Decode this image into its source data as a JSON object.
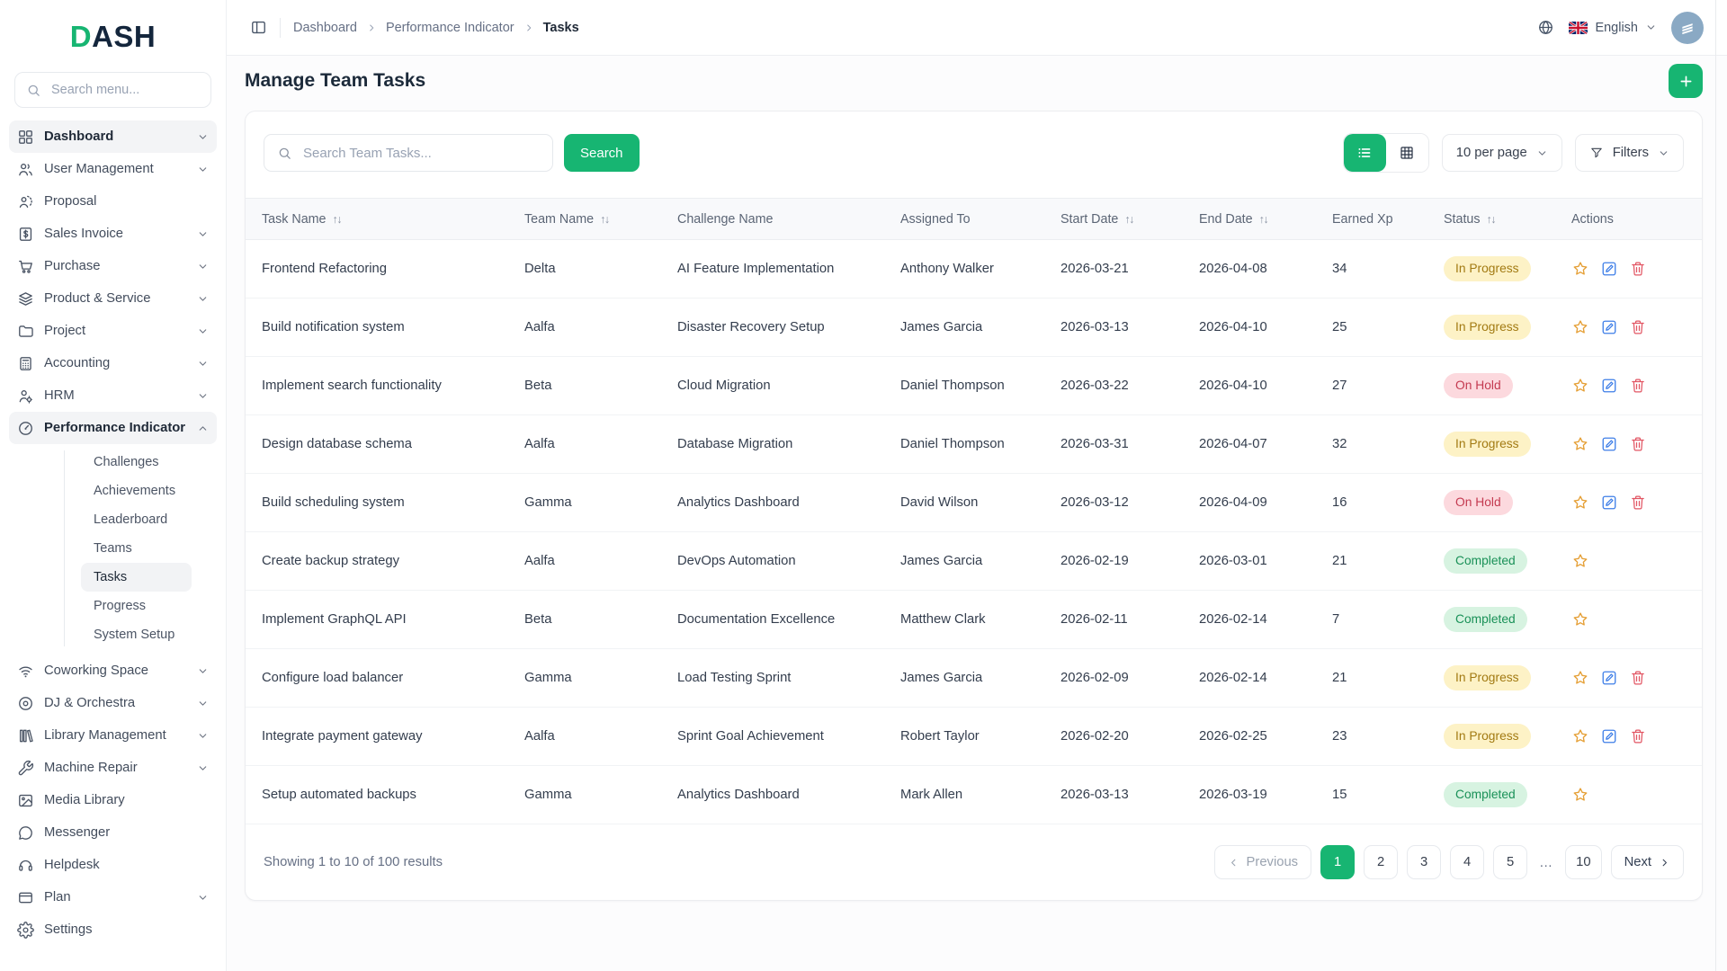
{
  "brand": {
    "logo_first": "D",
    "logo_rest": "ASH"
  },
  "sidebar": {
    "search_placeholder": "Search menu...",
    "items": [
      {
        "label": "Dashboard",
        "icon": "dashboard",
        "chevron": "down",
        "active": true
      },
      {
        "label": "User Management",
        "icon": "users",
        "chevron": "down"
      },
      {
        "label": "Proposal",
        "icon": "proposal"
      },
      {
        "label": "Sales Invoice",
        "icon": "invoice",
        "chevron": "down"
      },
      {
        "label": "Purchase",
        "icon": "cart",
        "chevron": "down"
      },
      {
        "label": "Product & Service",
        "icon": "layers",
        "chevron": "down"
      },
      {
        "label": "Project",
        "icon": "folder",
        "chevron": "down"
      },
      {
        "label": "Accounting",
        "icon": "calculator",
        "chevron": "down"
      },
      {
        "label": "HRM",
        "icon": "hrm",
        "chevron": "down"
      },
      {
        "label": "Performance Indicator",
        "icon": "gauge",
        "chevron": "up",
        "active": true,
        "children": [
          {
            "label": "Challenges"
          },
          {
            "label": "Achievements"
          },
          {
            "label": "Leaderboard"
          },
          {
            "label": "Teams"
          },
          {
            "label": "Tasks",
            "active": true
          },
          {
            "label": "Progress"
          },
          {
            "label": "System Setup"
          }
        ]
      },
      {
        "label": "Coworking Space",
        "icon": "wifi",
        "chevron": "down"
      },
      {
        "label": "DJ & Orchestra",
        "icon": "disc",
        "chevron": "down"
      },
      {
        "label": "Library Management",
        "icon": "book",
        "chevron": "down"
      },
      {
        "label": "Machine Repair",
        "icon": "wrench",
        "chevron": "down"
      },
      {
        "label": "Media Library",
        "icon": "image"
      },
      {
        "label": "Messenger",
        "icon": "chat"
      },
      {
        "label": "Helpdesk",
        "icon": "headset"
      },
      {
        "label": "Plan",
        "icon": "card",
        "chevron": "down"
      },
      {
        "label": "Settings",
        "icon": "gear"
      }
    ]
  },
  "topbar": {
    "breadcrumb": [
      "Dashboard",
      "Performance Indicator",
      "Tasks"
    ],
    "language": "English"
  },
  "page": {
    "title": "Manage Team Tasks"
  },
  "toolbar": {
    "search_placeholder": "Search Team Tasks...",
    "search_button": "Search",
    "per_page": "10 per page",
    "filters_label": "Filters"
  },
  "table": {
    "columns": [
      {
        "label": "Task Name",
        "sortable": true
      },
      {
        "label": "Team Name",
        "sortable": true
      },
      {
        "label": "Challenge Name",
        "sortable": false
      },
      {
        "label": "Assigned To",
        "sortable": false
      },
      {
        "label": "Start Date",
        "sortable": true
      },
      {
        "label": "End Date",
        "sortable": true
      },
      {
        "label": "Earned Xp",
        "sortable": false
      },
      {
        "label": "Status",
        "sortable": true
      },
      {
        "label": "Actions",
        "sortable": false
      }
    ],
    "rows": [
      {
        "task": "Frontend Refactoring",
        "team": "Delta",
        "challenge": "AI Feature Implementation",
        "assigned": "Anthony Walker",
        "start": "2026-03-21",
        "end": "2026-04-08",
        "xp": "34",
        "status": "In Progress",
        "actions": [
          "star",
          "edit",
          "delete"
        ]
      },
      {
        "task": "Build notification system",
        "team": "Aalfa",
        "challenge": "Disaster Recovery Setup",
        "assigned": "James Garcia",
        "start": "2026-03-13",
        "end": "2026-04-10",
        "xp": "25",
        "status": "In Progress",
        "actions": [
          "star",
          "edit",
          "delete"
        ]
      },
      {
        "task": "Implement search functionality",
        "team": "Beta",
        "challenge": "Cloud Migration",
        "assigned": "Daniel Thompson",
        "start": "2026-03-22",
        "end": "2026-04-10",
        "xp": "27",
        "status": "On Hold",
        "actions": [
          "star",
          "edit",
          "delete"
        ]
      },
      {
        "task": "Design database schema",
        "team": "Aalfa",
        "challenge": "Database Migration",
        "assigned": "Daniel Thompson",
        "start": "2026-03-31",
        "end": "2026-04-07",
        "xp": "32",
        "status": "In Progress",
        "actions": [
          "star",
          "edit",
          "delete"
        ]
      },
      {
        "task": "Build scheduling system",
        "team": "Gamma",
        "challenge": "Analytics Dashboard",
        "assigned": "David Wilson",
        "start": "2026-03-12",
        "end": "2026-04-09",
        "xp": "16",
        "status": "On Hold",
        "actions": [
          "star",
          "edit",
          "delete"
        ]
      },
      {
        "task": "Create backup strategy",
        "team": "Aalfa",
        "challenge": "DevOps Automation",
        "assigned": "James Garcia",
        "start": "2026-02-19",
        "end": "2026-03-01",
        "xp": "21",
        "status": "Completed",
        "actions": [
          "star"
        ]
      },
      {
        "task": "Implement GraphQL API",
        "team": "Beta",
        "challenge": "Documentation Excellence",
        "assigned": "Matthew Clark",
        "start": "2026-02-11",
        "end": "2026-02-14",
        "xp": "7",
        "status": "Completed",
        "actions": [
          "star"
        ]
      },
      {
        "task": "Configure load balancer",
        "team": "Gamma",
        "challenge": "Load Testing Sprint",
        "assigned": "James Garcia",
        "start": "2026-02-09",
        "end": "2026-02-14",
        "xp": "21",
        "status": "In Progress",
        "actions": [
          "star",
          "edit",
          "delete"
        ]
      },
      {
        "task": "Integrate payment gateway",
        "team": "Aalfa",
        "challenge": "Sprint Goal Achievement",
        "assigned": "Robert Taylor",
        "start": "2026-02-20",
        "end": "2026-02-25",
        "xp": "23",
        "status": "In Progress",
        "actions": [
          "star",
          "edit",
          "delete"
        ]
      },
      {
        "task": "Setup automated backups",
        "team": "Gamma",
        "challenge": "Analytics Dashboard",
        "assigned": "Mark Allen",
        "start": "2026-03-13",
        "end": "2026-03-19",
        "xp": "15",
        "status": "Completed",
        "actions": [
          "star"
        ]
      }
    ]
  },
  "pagination": {
    "summary": "Showing 1 to 10 of 100 results",
    "previous_label": "Previous",
    "next_label": "Next",
    "pages": [
      "1",
      "2",
      "3",
      "4",
      "5",
      "…",
      "10"
    ],
    "active_page": "1"
  },
  "colors": {
    "accent": "#17b572",
    "badge_in_progress_bg": "#fdf2c6",
    "badge_in_progress_text": "#a27a12",
    "badge_on_hold_bg": "#fcd9de",
    "badge_on_hold_text": "#c43a50",
    "badge_completed_bg": "#d7f3e1",
    "badge_completed_text": "#1a9158",
    "star_icon": "#e59f35",
    "edit_icon": "#3f7fe8",
    "delete_icon": "#e25563"
  }
}
